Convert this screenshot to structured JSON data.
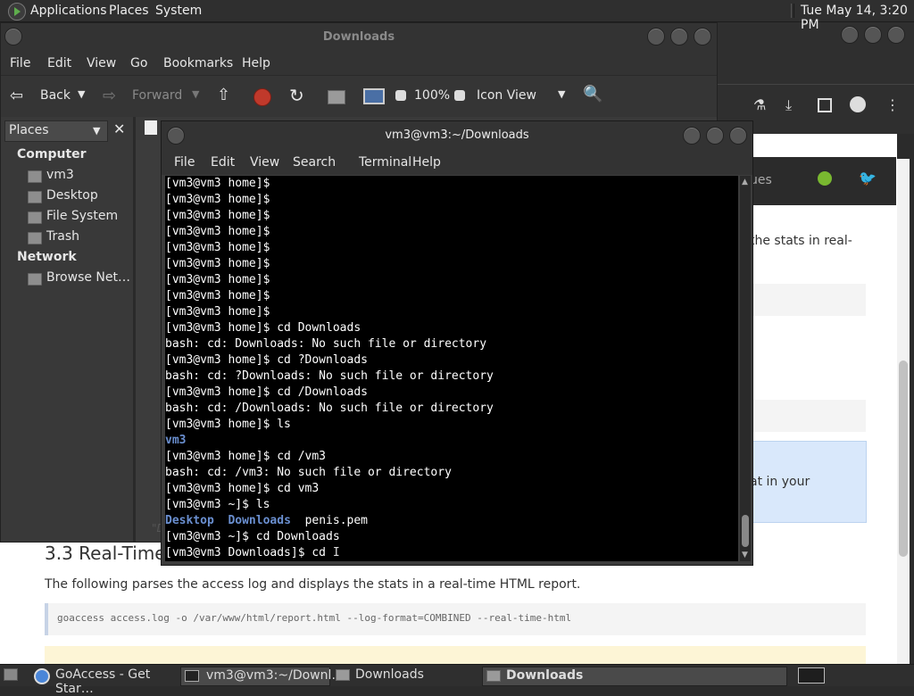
{
  "top_panel": {
    "menus": [
      "Applications",
      "Places",
      "System"
    ],
    "clock": "Tue May 14,  3:20 PM"
  },
  "browser": {
    "nav_fragment": "ues",
    "text_fragment_1": "the stats in real-",
    "text_fragment_2": "at in your",
    "section_heading": "3.3 Real-Time",
    "paragraph": "The following parses the access log and displays the stats in a real-time HTML report.",
    "code": "goaccess access.log -o /var/www/html/report.html --log-format=COMBINED --real-time-html",
    "colors": {
      "github": "#79b830",
      "twitter": "#1da1f2"
    }
  },
  "nautilus": {
    "title": "Downloads",
    "menu": [
      "File",
      "Edit",
      "View",
      "Go",
      "Bookmarks",
      "Help"
    ],
    "toolbar": {
      "back": "Back",
      "forward": "Forward",
      "zoom": "100%",
      "view": "Icon View"
    },
    "places_label": "Places",
    "sidebar": {
      "computer_head": "Computer",
      "computer_items": [
        "vm3",
        "Desktop",
        "File System",
        "Trash"
      ],
      "network_head": "Network",
      "network_items": [
        "Browse Net…"
      ]
    },
    "status_fragment": "\"D"
  },
  "terminal": {
    "title": "vm3@vm3:~/Downloads",
    "menu": [
      "File",
      "Edit",
      "View",
      "Search",
      "Terminal",
      "Help"
    ],
    "lines": [
      "[vm3@vm3 home]$",
      "[vm3@vm3 home]$",
      "[vm3@vm3 home]$",
      "[vm3@vm3 home]$",
      "[vm3@vm3 home]$",
      "[vm3@vm3 home]$",
      "[vm3@vm3 home]$",
      "[vm3@vm3 home]$",
      "[vm3@vm3 home]$",
      "[vm3@vm3 home]$ cd Downloads",
      "bash: cd: Downloads: No such file or directory",
      "[vm3@vm3 home]$ cd ?Downloads",
      "bash: cd: ?Downloads: No such file or directory",
      "[vm3@vm3 home]$ cd /Downloads",
      "bash: cd: /Downloads: No such file or directory",
      "[vm3@vm3 home]$ ls",
      "vm3",
      "[vm3@vm3 home]$ cd /vm3",
      "bash: cd: /vm3: No such file or directory",
      "[vm3@vm3 home]$ cd vm3",
      "[vm3@vm3 ~]$ ls",
      "Desktop  Downloads  penis.pem",
      "[vm3@vm3 ~]$ cd Downloads",
      "[vm3@vm3 Downloads]$ cd "
    ]
  },
  "taskbar": {
    "items": [
      "GoAccess - Get Star…",
      "vm3@vm3:~/Downl…",
      "Downloads",
      "Downloads"
    ]
  }
}
